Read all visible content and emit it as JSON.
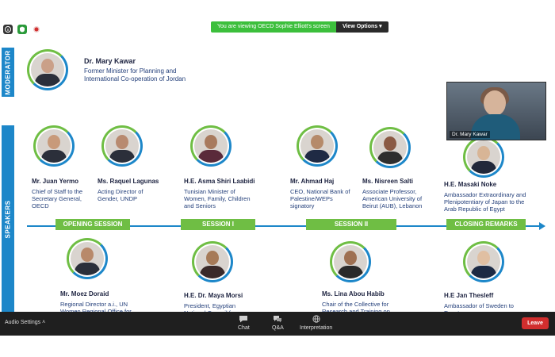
{
  "top": {
    "banner_message": "You are viewing OECD Sophie Elliott's screen",
    "view_options": "View Options"
  },
  "slide": {
    "moderator_label": "MODERATOR",
    "speakers_label": "SPEAKERS",
    "moderator": {
      "name": "Dr. Mary Kawar",
      "title_line1": "Former Minister for Planning and",
      "title_line2": "International Co-operation of Jordan"
    },
    "speakers_top": [
      {
        "name": "Mr. Juan Yermo",
        "l1": "Chief of Staff to the",
        "l2": "Secretary General,",
        "l3": "OECD"
      },
      {
        "name": "Ms. Raquel Lagunas",
        "l1": "Acting Director of",
        "l2": "Gender, UNDP",
        "l3": ""
      },
      {
        "name": "H.E. Asma Shiri Laabidi",
        "l1": "Tunisian Minister of",
        "l2": "Women, Family, Children",
        "l3": "and Seniors"
      },
      {
        "name": "Mr. Ahmad Haj",
        "l1": "CEO, National Bank of",
        "l2": "Palestine/WEPs",
        "l3": "signatory"
      },
      {
        "name": "Ms. Nisreen Salti",
        "l1": "Associate Professor,",
        "l2": "American University of",
        "l3": "Beirut (AUB), Lebanon"
      },
      {
        "name": "H.E. Masaki Noke",
        "l1": "Ambassador Extraordinary and",
        "l2": "Plenipotentiary of Japan to the",
        "l3": "Arab Republic of Egypt"
      }
    ],
    "sessions": [
      "OPENING SESSION",
      "SESSION I",
      "SESSION II",
      "CLOSING REMARKS"
    ],
    "speakers_bottom": [
      {
        "name": "Mr. Moez Doraid",
        "l1": "Regional Director a.i., UN",
        "l2": "Women Regional Office for"
      },
      {
        "name": "H.E. Dr. Maya Morsi",
        "l1": "President, Egyptian",
        "l2": "National Council for"
      },
      {
        "name": "Ms. Lina Abou Habib",
        "l1": "Chair of the Collective for",
        "l2": "Research and Training on"
      },
      {
        "name": "H.E Jan Thesleff",
        "l1": "Ambassador of Sweden to",
        "l2": "Egypt"
      }
    ]
  },
  "video_tile": {
    "participant_name": "Dr. Mary Kawar"
  },
  "bottom_bar": {
    "audio_settings": "Audio Settings",
    "chat": "Chat",
    "qa": "Q&A",
    "interpretation": "Interpretation",
    "leave": "Leave"
  },
  "colors": {
    "accent_blue": "#1d87c9",
    "accent_green": "#6fbe44",
    "leave_red": "#d12e2e"
  }
}
